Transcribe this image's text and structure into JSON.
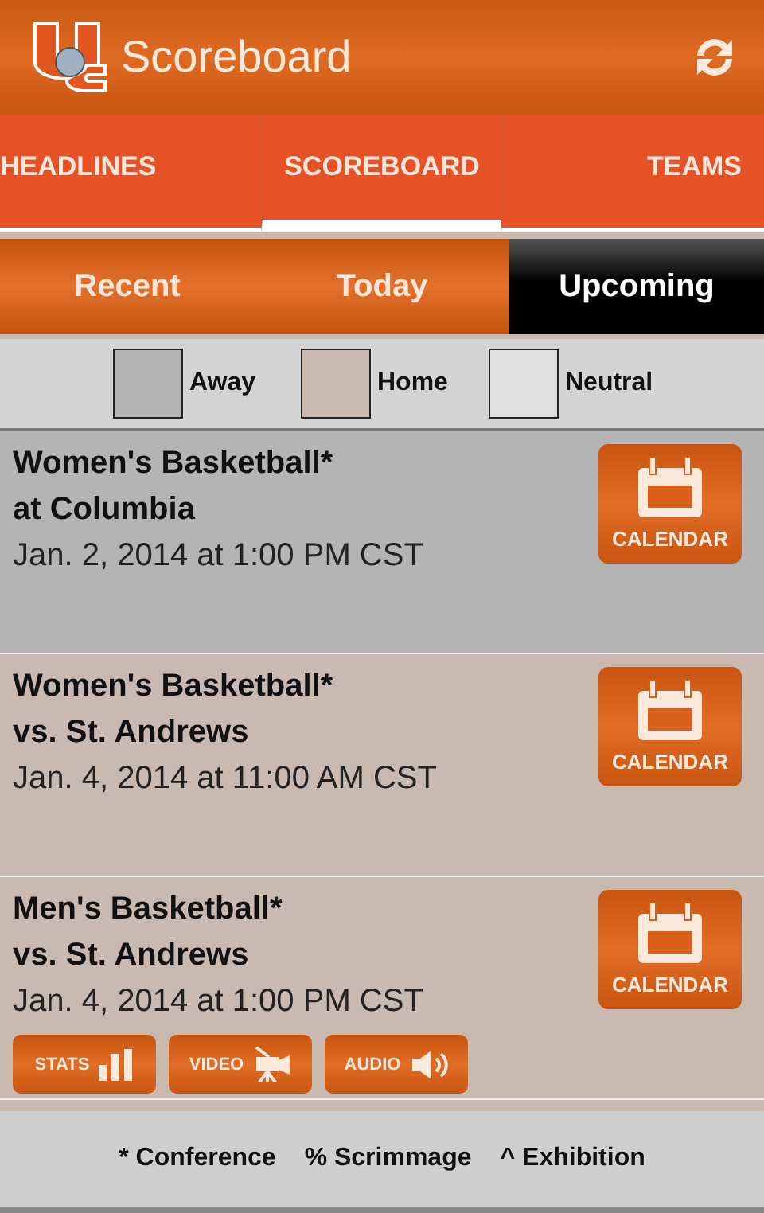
{
  "header": {
    "title": "Scoreboard"
  },
  "tabs": [
    {
      "label": "HEADLINES",
      "selected": false
    },
    {
      "label": "SCOREBOARD",
      "selected": true
    },
    {
      "label": "TEAMS",
      "selected": false
    }
  ],
  "segments": [
    {
      "label": "Recent",
      "selected": false
    },
    {
      "label": "Today",
      "selected": false
    },
    {
      "label": "Upcoming",
      "selected": true
    }
  ],
  "legend": [
    {
      "label": "Away",
      "color": "#b4b4b4"
    },
    {
      "label": "Home",
      "color": "#c8b9b1"
    },
    {
      "label": "Neutral",
      "color": "#e0e0e0"
    }
  ],
  "games": [
    {
      "color": "#b4b4b4",
      "sport": "Women's Basketball*",
      "opponent": "at Columbia",
      "date": "Jan. 2, 2014 at 1:00 PM CST",
      "calendar": "CALENDAR"
    },
    {
      "color": "#c8b9b1",
      "sport": "Women's Basketball*",
      "opponent": "vs. St. Andrews",
      "date": "Jan. 4, 2014 at 11:00 AM CST",
      "calendar": "CALENDAR"
    },
    {
      "color": "#c8b9b1",
      "sport": "Men's Basketball*",
      "opponent": "vs. St. Andrews",
      "date": "Jan. 4, 2014 at 1:00 PM CST",
      "calendar": "CALENDAR",
      "media": [
        {
          "kind": "stats",
          "label": "STATS"
        },
        {
          "kind": "video",
          "label": "VIDEO"
        },
        {
          "kind": "audio",
          "label": "AUDIO"
        }
      ]
    }
  ],
  "footer": [
    "* Conference",
    "% Scrimmage",
    "^ Exhibition"
  ]
}
